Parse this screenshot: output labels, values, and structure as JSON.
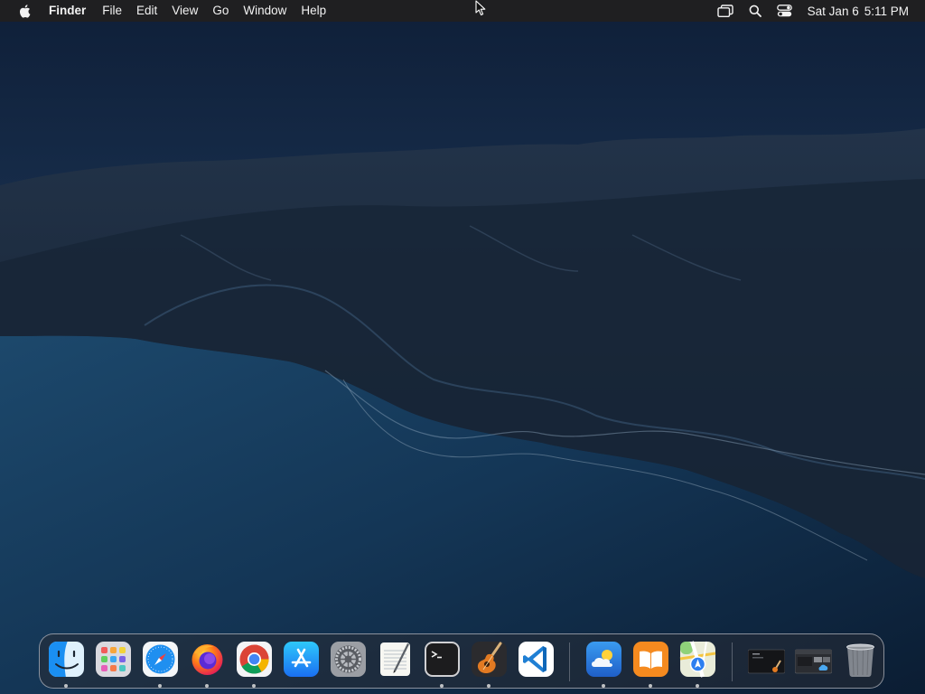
{
  "menubar": {
    "apple_icon": "apple-logo-icon",
    "app_name": "Finder",
    "menus": [
      "File",
      "Edit",
      "View",
      "Go",
      "Window",
      "Help"
    ],
    "status_icons": [
      "screen-mirroring-icon",
      "spotlight-search-icon",
      "control-center-icon"
    ],
    "clock": {
      "date": "Sat Jan 6",
      "time": "5:11 PM"
    }
  },
  "dock": {
    "apps": [
      {
        "name": "Finder",
        "icon": "finder-icon",
        "running": true
      },
      {
        "name": "Launchpad",
        "icon": "launchpad-icon",
        "running": false
      },
      {
        "name": "Safari",
        "icon": "safari-icon",
        "running": true
      },
      {
        "name": "Firefox",
        "icon": "firefox-icon",
        "running": true
      },
      {
        "name": "Google Chrome",
        "icon": "chrome-icon",
        "running": true
      },
      {
        "name": "App Store",
        "icon": "app-store-icon",
        "running": false
      },
      {
        "name": "System Settings",
        "icon": "system-settings-icon",
        "running": false
      },
      {
        "name": "TextEdit",
        "icon": "textedit-icon",
        "running": false
      },
      {
        "name": "Terminal",
        "icon": "terminal-icon",
        "running": true
      },
      {
        "name": "GarageBand",
        "icon": "garageband-icon",
        "running": true
      },
      {
        "name": "Visual Studio Code",
        "icon": "vscode-icon",
        "running": false
      },
      {
        "name": "Weather",
        "icon": "weather-icon",
        "running": true
      },
      {
        "name": "Books",
        "icon": "books-icon",
        "running": true
      },
      {
        "name": "Maps",
        "icon": "maps-icon",
        "running": true
      }
    ],
    "minimized": [
      {
        "name": "Minimized window 1",
        "icon": "minimized-window-icon"
      },
      {
        "name": "Minimized window 2",
        "icon": "minimized-window-icon"
      }
    ],
    "trash": {
      "name": "Trash",
      "icon": "trash-icon"
    }
  },
  "colors": {
    "menubar_bg": "#1f1f21",
    "sky_top": "#12233d",
    "ocean": "#0f2a44",
    "mountains": "#1b2838"
  }
}
